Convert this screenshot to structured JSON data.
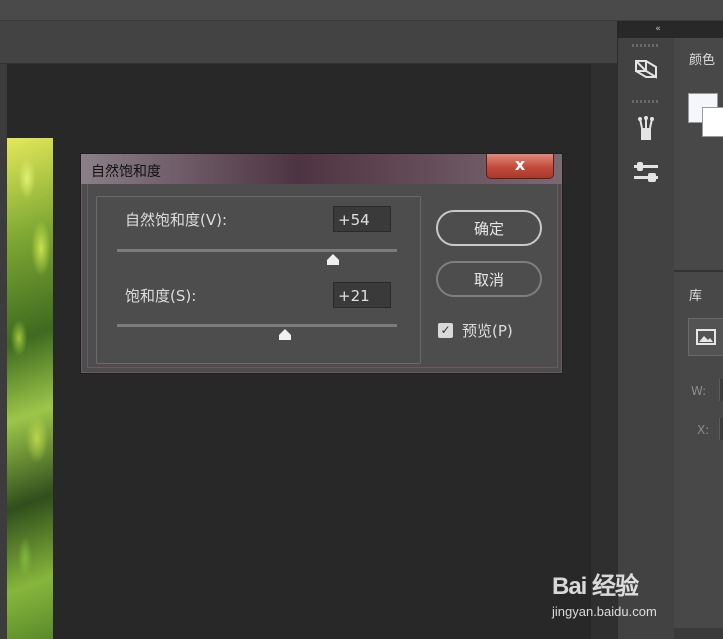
{
  "dialog": {
    "title": "自然饱和度",
    "close_label": "x",
    "vibrance": {
      "label": "自然饱和度(V):",
      "value": "+54",
      "level_percent": 77
    },
    "saturation": {
      "label": "饱和度(S):",
      "value": "+21",
      "level_percent": 60
    },
    "ok_label": "确定",
    "cancel_label": "取消",
    "preview": {
      "label": "预览(P)",
      "checked": true
    }
  },
  "right_panel": {
    "color_title": "颜色",
    "library_title": "库",
    "w_label": "W:",
    "x_label": "X:",
    "foreground_color": "#f4f6fb",
    "background_color": "#ffffff"
  },
  "panel_collapse_label": "«",
  "tools": [
    {
      "icon": "3d-object-icon"
    },
    {
      "icon": "brush-presets-icon"
    },
    {
      "icon": "adjustments-sliders-icon"
    }
  ],
  "watermark": {
    "logo": "Bai 经验",
    "url": "jingyan.baidu.com"
  }
}
